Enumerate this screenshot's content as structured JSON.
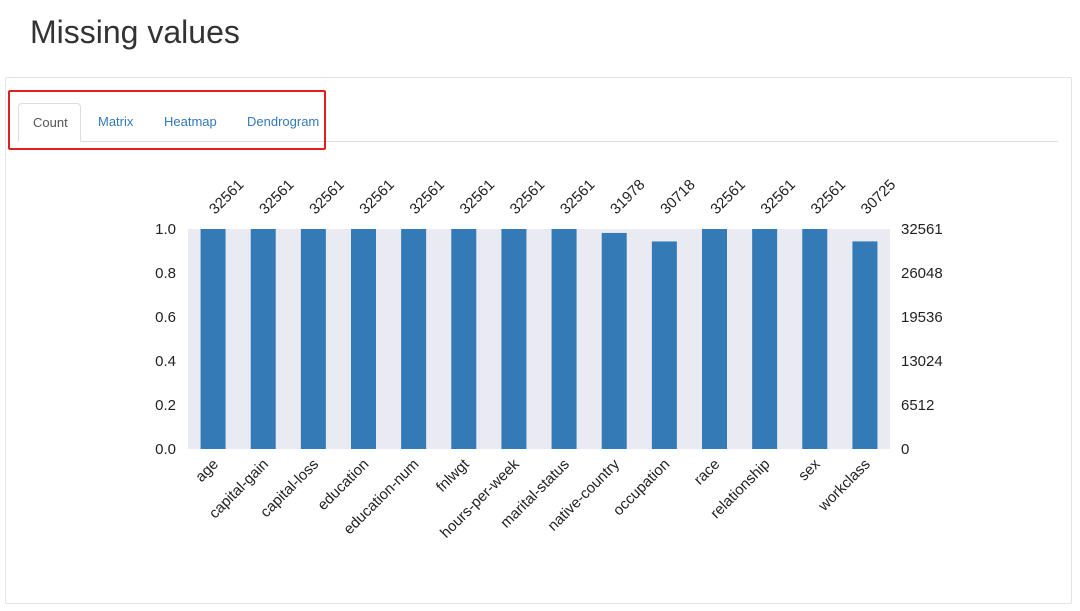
{
  "page": {
    "title": "Missing values"
  },
  "tabs": [
    {
      "label": "Count",
      "active": true
    },
    {
      "label": "Matrix",
      "active": false
    },
    {
      "label": "Heatmap",
      "active": false
    },
    {
      "label": "Dendrogram",
      "active": false
    }
  ],
  "colors": {
    "bar": "#337ab7",
    "plot_background": "#eaeaf2",
    "highlight": "#e02020",
    "link": "#337ab7"
  },
  "chart_data": {
    "type": "bar",
    "categories": [
      "age",
      "capital-gain",
      "capital-loss",
      "education",
      "education-num",
      "fnlwgt",
      "hours-per-week",
      "marital-status",
      "native-country",
      "occupation",
      "race",
      "relationship",
      "sex",
      "workclass"
    ],
    "values": [
      32561,
      32561,
      32561,
      32561,
      32561,
      32561,
      32561,
      32561,
      31978,
      30718,
      32561,
      32561,
      32561,
      30725
    ],
    "total": 32561,
    "top_labels": [
      "32561",
      "32561",
      "32561",
      "32561",
      "32561",
      "32561",
      "32561",
      "32561",
      "31978",
      "30718",
      "32561",
      "32561",
      "32561",
      "30725"
    ],
    "left_axis": {
      "range": [
        0,
        1
      ],
      "ticks": [
        "0.0",
        "0.2",
        "0.4",
        "0.6",
        "0.8",
        "1.0"
      ]
    },
    "right_axis": {
      "ticks": [
        "0",
        "6512",
        "13024",
        "19536",
        "26048",
        "32561"
      ]
    },
    "grid": false
  }
}
